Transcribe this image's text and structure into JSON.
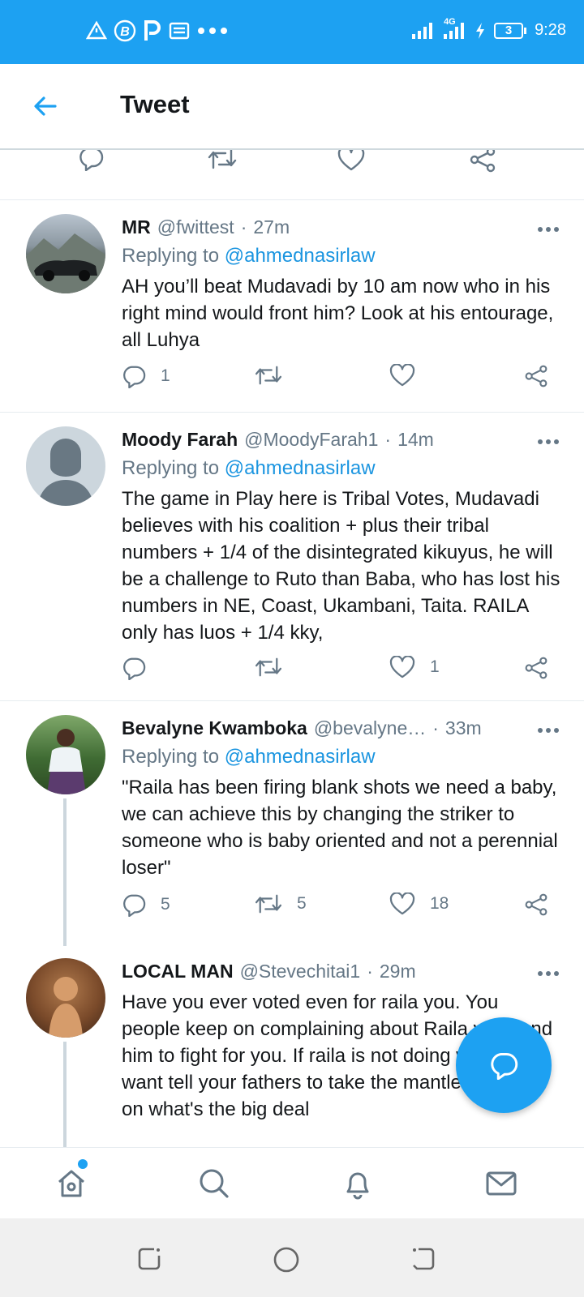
{
  "status_bar": {
    "time": "9:28",
    "network": "4G",
    "battery": "3",
    "left_icons": [
      "alert-triangle-icon",
      "b-circle-icon",
      "p-icon",
      "news-icon",
      "more-dots-icon"
    ]
  },
  "header": {
    "title": "Tweet",
    "back_icon": "back-arrow-icon"
  },
  "tweets": [
    {
      "name": "MR",
      "handle": "@fwittest",
      "time": "27m",
      "replying_prefix": "Replying to ",
      "replying_to": "@ahmednasirlaw",
      "text": "AH you’ll beat Mudavadi by 10 am now who in his right mind would front him? Look at his entourage, all Luhya",
      "replies": "1",
      "retweets": "",
      "likes": ""
    },
    {
      "name": "Moody Farah",
      "handle": "@MoodyFarah1",
      "time": "14m",
      "replying_prefix": "Replying to ",
      "replying_to": "@ahmednasirlaw",
      "text": "The game in Play here is Tribal Votes, Mudavadi believes with his coalition + plus their tribal numbers + 1/4 of the disintegrated kikuyus, he will be a challenge to Ruto than Baba, who has lost his numbers in NE, Coast, Ukambani, Taita. RAILA only has luos + 1/4 kky,",
      "replies": "",
      "retweets": "",
      "likes": "1"
    },
    {
      "name": "Bevalyne Kwamboka",
      "handle": "@bevalyne…",
      "time": "33m",
      "replying_prefix": "Replying to ",
      "replying_to": "@ahmednasirlaw",
      "text": "\"Raila has been firing blank shots we need a baby, we can achieve this by changing the striker to someone who is baby oriented and not a perennial loser\"",
      "replies": "5",
      "retweets": "5",
      "likes": "18"
    },
    {
      "name": "LOCAL MAN",
      "handle": "@Stevechitai1",
      "time": "29m",
      "text": "Have you ever voted even for raila you. You people keep on complaining about Raila you send him to fight for you. If raila is not doing what you want tell your fathers to take the mantle and carry on what's the big deal"
    }
  ],
  "fab": {
    "icon": "compose-reply-icon"
  },
  "bottom_nav": [
    "home-icon",
    "search-icon",
    "notifications-icon",
    "messages-icon"
  ],
  "colors": {
    "accent": "#1da1f2",
    "muted": "#657786",
    "link": "#1b95e0"
  }
}
